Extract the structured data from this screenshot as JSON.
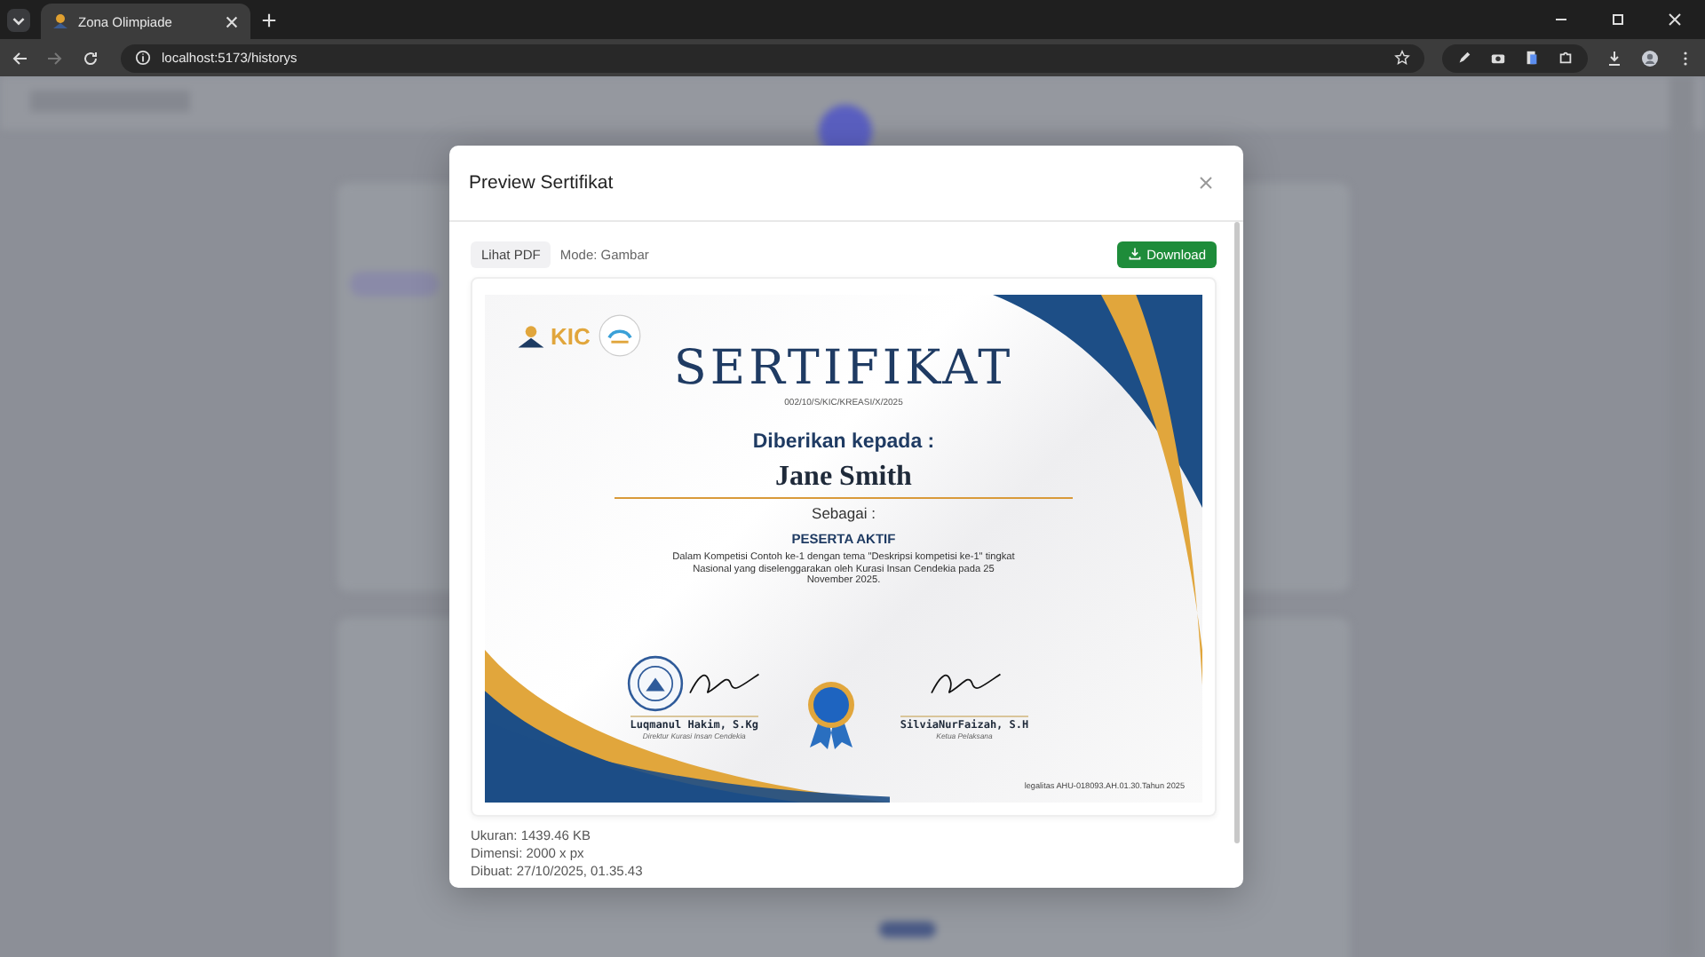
{
  "browser": {
    "tab_title": "Zona Olimpiade",
    "url": "localhost:5173/historys"
  },
  "modal": {
    "title": "Preview Sertifikat",
    "view_pdf_button": "Lihat PDF",
    "mode": "Mode: Gambar",
    "download_button": "Download",
    "certificate": {
      "logo_text": "KIC",
      "heading": "SERTIFIKAT",
      "number": "002/10/S/KIC/KREASI/X/2025",
      "given_to": "Diberikan kepada :",
      "recipient": "Jane Smith",
      "as": "Sebagai :",
      "role": "PESERTA AKTIF",
      "description": "Dalam Kompetisi Contoh ke-1 dengan tema \"Deskripsi kompetisi ke-1\" tingkat Nasional yang diselenggarakan oleh Kurasi Insan Cendekia pada 25 November 2025.",
      "signatories": [
        {
          "name": "Luqmanul Hakim, S.Kg",
          "position": "Direktur Kurasi Insan Cendekia",
          "stamp": true
        },
        {
          "name": "SilviaNurFaizah, S.H",
          "position": "Ketua Pelaksana",
          "stamp": false
        }
      ],
      "legal": "legalitas AHU-018093.AH.01.30.Tahun 2025"
    },
    "info": [
      "Ukuran: 1439.46 KB",
      "Dimensi: 2000 x px",
      "Dibuat: 27/10/2025, 01.35.43"
    ]
  }
}
